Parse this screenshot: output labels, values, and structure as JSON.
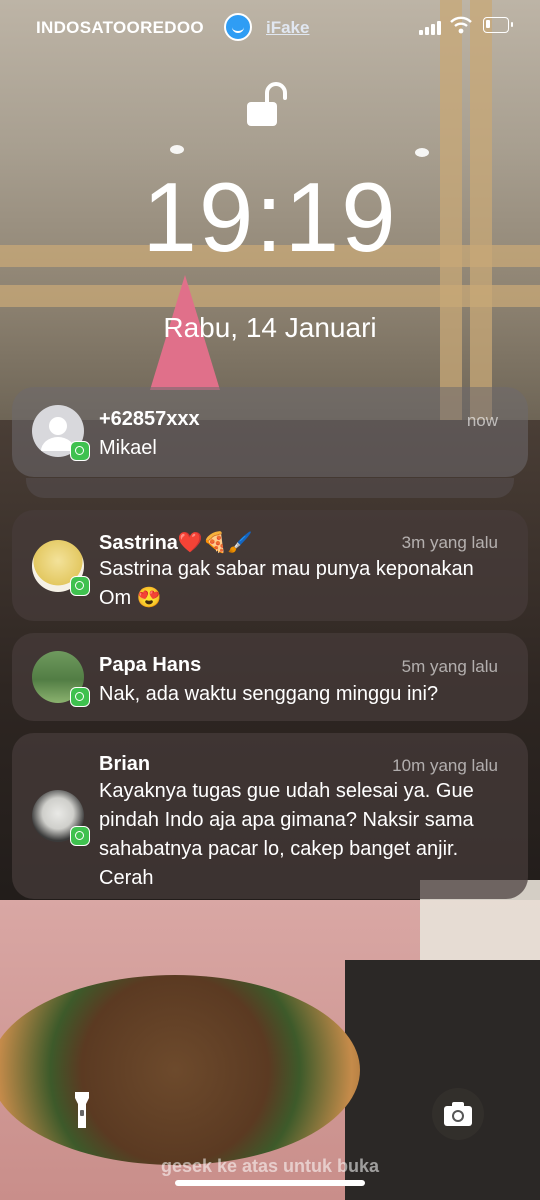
{
  "status_bar": {
    "carrier": "INDOSATOOREDOO",
    "app_name": "iFake"
  },
  "lock": {
    "time": "19:19",
    "date": "Rabu, 14 Januari"
  },
  "notifications": [
    {
      "sender": "+62857xxx",
      "time": "now",
      "message": "Mikael"
    },
    {
      "sender": "Sastrina❤️🍕🖌️",
      "time": "3m yang lalu",
      "message": "Sastrina gak sabar mau punya keponakan Om 😍"
    },
    {
      "sender": "Papa Hans",
      "time": "5m yang lalu",
      "message": "Nak, ada waktu senggang minggu ini?"
    },
    {
      "sender": "Brian",
      "time": "10m yang lalu",
      "message": "Kayaknya tugas gue udah selesai ya. Gue pindah Indo aja apa gimana? Naksir sama sahabatnya pacar lo, cakep banget anjir. Cerah"
    }
  ],
  "bottom": {
    "swipe_hint": "gesek ke atas untuk buka"
  },
  "colors": {
    "whatsapp": "#3fc14f",
    "ifake": "#2f9df4"
  },
  "icons": [
    "lock-open-icon",
    "whatsapp-icon",
    "flashlight-icon",
    "camera-icon",
    "signal-icon",
    "wifi-icon",
    "battery-icon"
  ]
}
